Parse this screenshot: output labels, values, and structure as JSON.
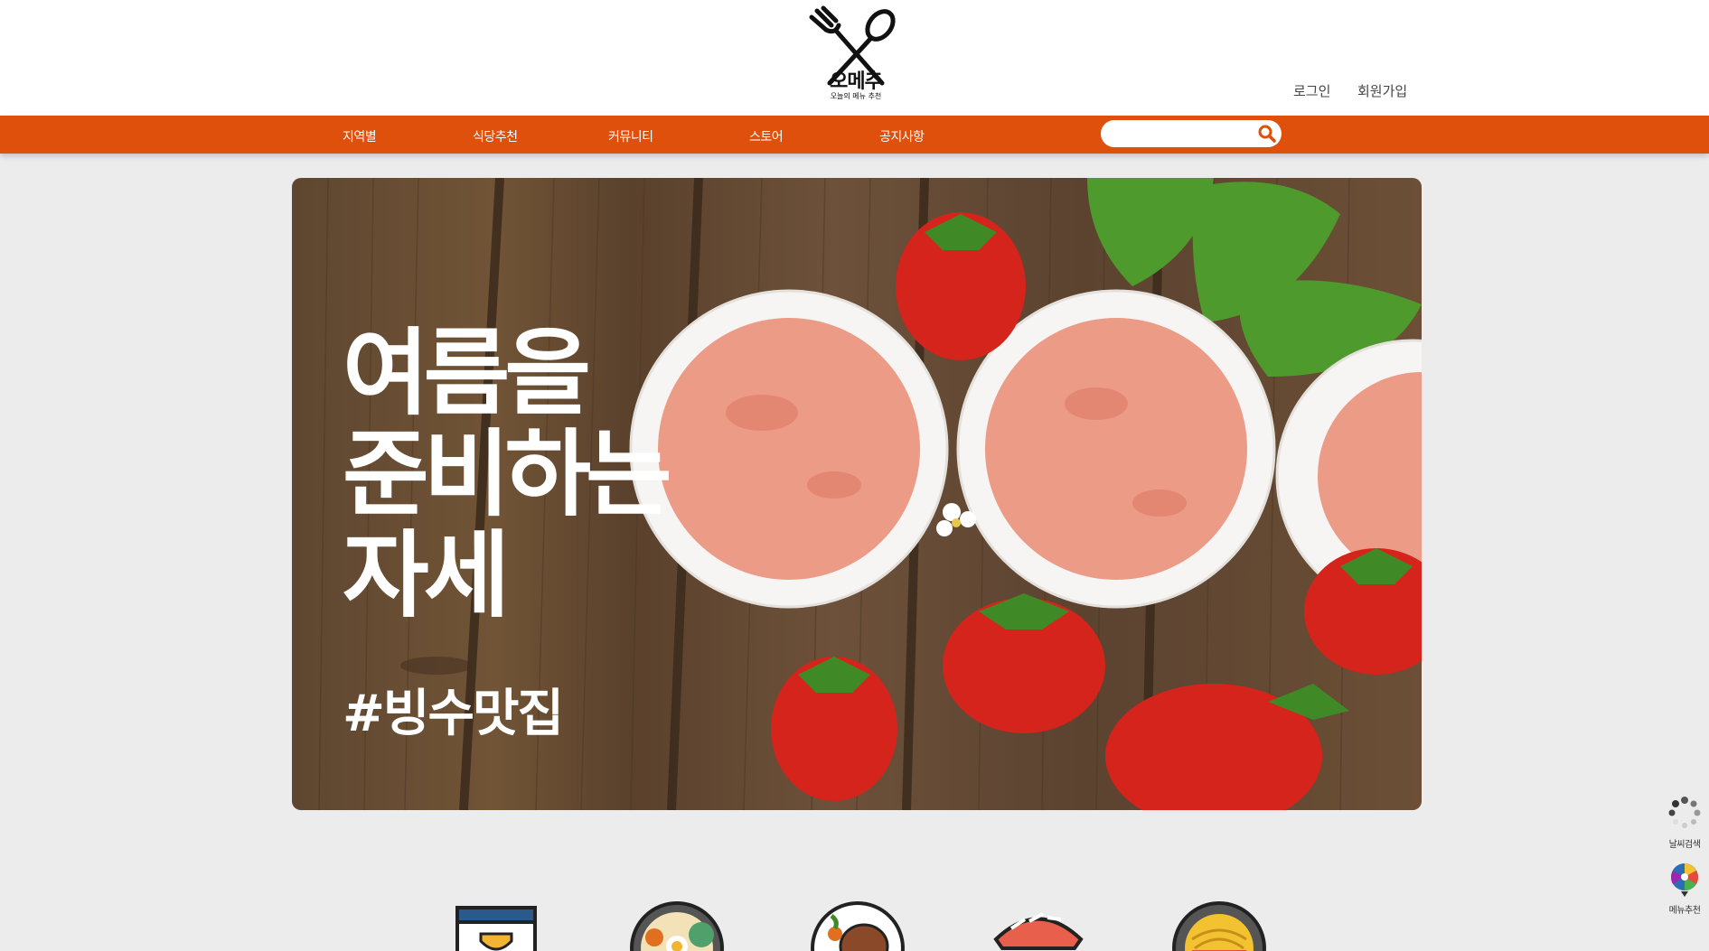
{
  "brand": {
    "name": "오메추",
    "tagline": "오늘의 메뉴 추천"
  },
  "auth": {
    "login": "로그인",
    "signup": "회원가입"
  },
  "nav": {
    "items": [
      "지역별",
      "식당추천",
      "커뮤니티",
      "스토어",
      "공지사항"
    ]
  },
  "search": {
    "placeholder": "",
    "value": ""
  },
  "banner": {
    "line1": "여름을",
    "line2": "준비하는",
    "line3": "자세",
    "hashtag": "#빙수맛집"
  },
  "side_widgets": {
    "weather": "날씨검색",
    "menu": "메뉴추천"
  },
  "categories": [
    "trophy-icon",
    "bibimbap-icon",
    "steak-icon",
    "sushi-icon",
    "noodle-icon"
  ],
  "colors": {
    "accent": "#e0500d",
    "background": "#ececec"
  }
}
